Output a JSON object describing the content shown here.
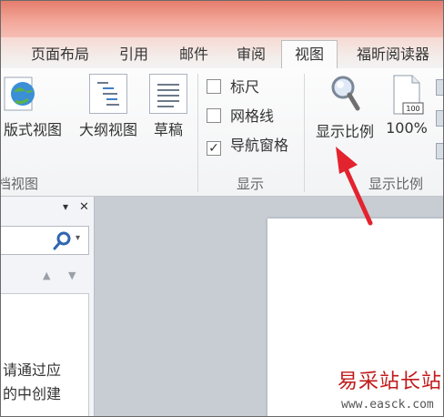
{
  "tabs": [
    {
      "label": "页面布局"
    },
    {
      "label": "引用"
    },
    {
      "label": "邮件"
    },
    {
      "label": "审阅"
    },
    {
      "label": "视图",
      "active": true
    },
    {
      "label": "福昕阅读器"
    }
  ],
  "ribbon": {
    "views_group": {
      "label": "档视图",
      "buttons": [
        {
          "label": "版式视图",
          "icon": "web-layout-icon"
        },
        {
          "label": "大纲视图",
          "icon": "outline-icon"
        },
        {
          "label": "草稿",
          "icon": "draft-icon"
        }
      ]
    },
    "show_group": {
      "label": "显示",
      "checkboxes": [
        {
          "label": "标尺",
          "checked": false
        },
        {
          "label": "网格线",
          "checked": false
        },
        {
          "label": "导航窗格",
          "checked": true
        }
      ]
    },
    "zoom_group": {
      "label": "显示比例",
      "buttons": [
        {
          "label": "显示比例",
          "icon": "magnifier-icon"
        },
        {
          "label": "100%",
          "icon": "page-100-icon"
        }
      ]
    }
  },
  "nav_pane": {
    "text_line1": "请通过应",
    "text_line2": "的中创建",
    "close_symbol": "✕",
    "menu_symbol": "▾",
    "search_icon": "search-icon"
  },
  "annotation": {
    "arrow_color": "#e3232e"
  },
  "watermark": {
    "title": "易采站长站",
    "url": "www.easck.com"
  },
  "colors": {
    "title_red": "#e57e6e",
    "accent": "#c21a1a"
  }
}
